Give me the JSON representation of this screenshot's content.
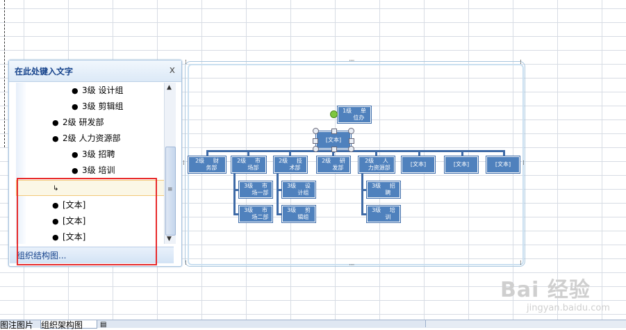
{
  "text_pane": {
    "title": "在此处键入文字",
    "close": "x",
    "rows": [
      {
        "text": "3级  设计组"
      },
      {
        "text": "3级  剪辑组"
      },
      {
        "text": "2级  研发部"
      },
      {
        "text": "2级  人力资源部"
      },
      {
        "text": "3级  招聘"
      },
      {
        "text": "3级  培训"
      },
      {
        "text": "↳"
      },
      {
        "text": "[文本]"
      },
      {
        "text": "[文本]"
      },
      {
        "text": "[文本]"
      }
    ],
    "footer": "组织结构图..."
  },
  "org_chart": {
    "top": "1级     单\n     位办",
    "assistant": "[文本]",
    "level2": [
      "2级     财\n     务部",
      "2级     市\n     场部",
      "2级     技\n     术部",
      "2级     研\n     发部",
      "2级     人\n   力资源部",
      "[文本]",
      "[文本]",
      "[文本]"
    ],
    "level3": [
      "3级     市\n     场一部",
      "3级     市\n     场二部",
      "3级     设\n     计组",
      "3级     剪\n     辑组",
      "3级     招\n     聘",
      "3级     培\n     训"
    ]
  },
  "sheet_tabs": {
    "tab_left": "图注图片",
    "tab_active": "组织架构图"
  },
  "watermark": {
    "logo": "Bai 经验",
    "sub": "jingyan.baidu.com"
  }
}
